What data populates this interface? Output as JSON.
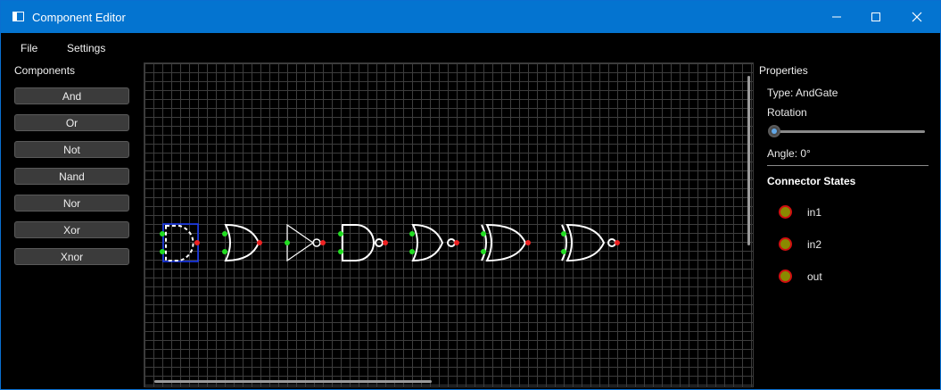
{
  "window": {
    "title": "Component Editor",
    "accent": "#0474d0",
    "icons": {
      "app": "app-window-icon",
      "minimize": "minimize-icon",
      "maximize": "maximize-icon",
      "close": "close-icon"
    }
  },
  "menu": {
    "file": "File",
    "settings": "Settings"
  },
  "components": {
    "label": "Components",
    "buttons": [
      "And",
      "Or",
      "Not",
      "Nand",
      "Nor",
      "Xor",
      "Xnor"
    ]
  },
  "canvas": {
    "grid_color": "#3d3d3d",
    "input_connector_color": "#22dd22",
    "output_connector_color": "#ee2222",
    "selection_color": "#1a3cff",
    "gates": [
      "AndGate (selected)",
      "OrGate",
      "NotGate",
      "NandGate",
      "NorGate",
      "XorGate",
      "XnorGate"
    ]
  },
  "properties": {
    "label": "Properties",
    "type": "Type: AndGate",
    "rotation_label": "Rotation",
    "rotation_value": 0,
    "angle": "Angle: 0°",
    "connector_heading": "Connector States",
    "connectors": [
      {
        "name": "in1",
        "state_color": "#8a8a00"
      },
      {
        "name": "in2",
        "state_color": "#8a8a00"
      },
      {
        "name": "out",
        "state_color": "#8a8a00"
      }
    ]
  }
}
